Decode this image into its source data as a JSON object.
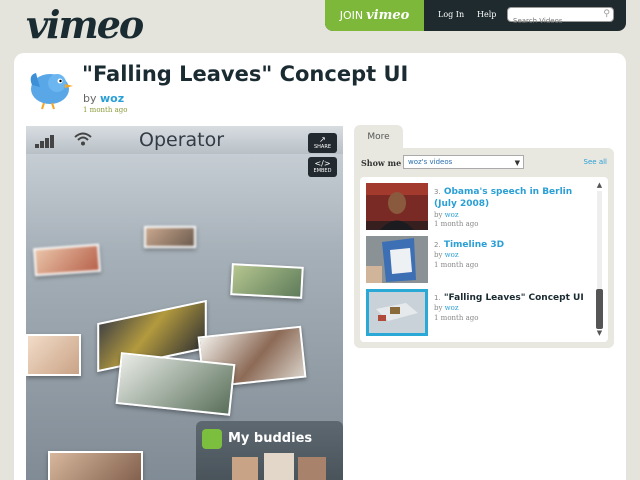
{
  "header": {
    "logo": "vimeo",
    "join_prefix": "JOIN",
    "join_brand": "vimeo",
    "login": "Log In",
    "help": "Help",
    "search_placeholder": "Search Videos"
  },
  "video": {
    "title": "\"Falling Leaves\" Concept UI",
    "by": "by",
    "author": "woz",
    "ago": "1 month ago",
    "player": {
      "carrier": "Operator",
      "share": "SHARE",
      "embed": "EMBED",
      "buddies": "My buddies"
    }
  },
  "more": {
    "tab": "More",
    "show_me": "Show me",
    "select_value": "woz's videos",
    "see_all": "See all",
    "items": [
      {
        "num": "3.",
        "title": "Obama's speech in Berlin (July 2008)",
        "by": "by",
        "author": "woz",
        "ago": "1 month ago"
      },
      {
        "num": "2.",
        "title": "Timeline 3D",
        "by": "by",
        "author": "woz",
        "ago": "1 month ago"
      },
      {
        "num": "1.",
        "title": "\"Falling Leaves\" Concept UI",
        "by": "by",
        "author": "woz",
        "ago": "1 month ago"
      }
    ]
  },
  "colors": {
    "accent_green": "#7eb83b",
    "link_blue": "#2a9fd6",
    "dark": "#1e2a2e"
  }
}
